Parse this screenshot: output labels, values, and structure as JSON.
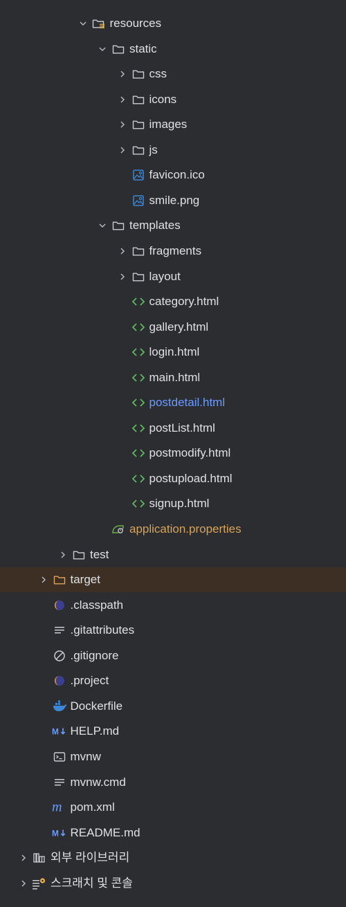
{
  "colors": {
    "background": "#2b2d30",
    "text": "#dfe1e5",
    "modified_blue": "#6b9bff",
    "ignored_orange": "#d6a35a",
    "highlight_row": "#3d2f23",
    "html_icon": "#5fb760",
    "image_icon": "#3d86d8"
  },
  "tree": {
    "items": [
      {
        "label": "resources",
        "depth": 3,
        "chevron": "down",
        "icon": "resources-folder-icon"
      },
      {
        "label": "static",
        "depth": 4,
        "chevron": "down",
        "icon": "folder-icon"
      },
      {
        "label": "css",
        "depth": 5,
        "chevron": "right",
        "icon": "folder-icon"
      },
      {
        "label": "icons",
        "depth": 5,
        "chevron": "right",
        "icon": "folder-icon"
      },
      {
        "label": "images",
        "depth": 5,
        "chevron": "right",
        "icon": "folder-icon"
      },
      {
        "label": "js",
        "depth": 5,
        "chevron": "right",
        "icon": "folder-icon"
      },
      {
        "label": "favicon.ico",
        "depth": 5,
        "chevron": "none",
        "icon": "image-file-icon"
      },
      {
        "label": "smile.png",
        "depth": 5,
        "chevron": "none",
        "icon": "image-file-icon"
      },
      {
        "label": "templates",
        "depth": 4,
        "chevron": "down",
        "icon": "folder-icon"
      },
      {
        "label": "fragments",
        "depth": 5,
        "chevron": "right",
        "icon": "folder-icon"
      },
      {
        "label": "layout",
        "depth": 5,
        "chevron": "right",
        "icon": "folder-icon"
      },
      {
        "label": "category.html",
        "depth": 5,
        "chevron": "none",
        "icon": "html-file-icon"
      },
      {
        "label": "gallery.html",
        "depth": 5,
        "chevron": "none",
        "icon": "html-file-icon"
      },
      {
        "label": "login.html",
        "depth": 5,
        "chevron": "none",
        "icon": "html-file-icon"
      },
      {
        "label": "main.html",
        "depth": 5,
        "chevron": "none",
        "icon": "html-file-icon"
      },
      {
        "label": "postdetail.html",
        "depth": 5,
        "chevron": "none",
        "icon": "html-file-icon",
        "style": "blue"
      },
      {
        "label": "postList.html",
        "depth": 5,
        "chevron": "none",
        "icon": "html-file-icon"
      },
      {
        "label": "postmodify.html",
        "depth": 5,
        "chevron": "none",
        "icon": "html-file-icon"
      },
      {
        "label": "postupload.html",
        "depth": 5,
        "chevron": "none",
        "icon": "html-file-icon"
      },
      {
        "label": "signup.html",
        "depth": 5,
        "chevron": "none",
        "icon": "html-file-icon"
      },
      {
        "label": "application.properties",
        "depth": 4,
        "chevron": "none",
        "icon": "properties-file-icon",
        "style": "orange"
      },
      {
        "label": "test",
        "depth": 2,
        "chevron": "right",
        "icon": "folder-icon"
      },
      {
        "label": "target",
        "depth": 1,
        "chevron": "right",
        "icon": "folder-orange-icon",
        "highlight": true
      },
      {
        "label": ".classpath",
        "depth": 1,
        "chevron": "none",
        "icon": "eclipse-icon"
      },
      {
        "label": ".gitattributes",
        "depth": 1,
        "chevron": "none",
        "icon": "text-lines-icon"
      },
      {
        "label": ".gitignore",
        "depth": 1,
        "chevron": "none",
        "icon": "ignore-icon"
      },
      {
        "label": ".project",
        "depth": 1,
        "chevron": "none",
        "icon": "eclipse-icon"
      },
      {
        "label": "Dockerfile",
        "depth": 1,
        "chevron": "none",
        "icon": "docker-icon"
      },
      {
        "label": "HELP.md",
        "depth": 1,
        "chevron": "none",
        "icon": "markdown-icon"
      },
      {
        "label": "mvnw",
        "depth": 1,
        "chevron": "none",
        "icon": "terminal-icon"
      },
      {
        "label": "mvnw.cmd",
        "depth": 1,
        "chevron": "none",
        "icon": "text-lines-icon"
      },
      {
        "label": "pom.xml",
        "depth": 1,
        "chevron": "none",
        "icon": "maven-icon"
      },
      {
        "label": "README.md",
        "depth": 1,
        "chevron": "none",
        "icon": "markdown-icon"
      },
      {
        "label": "외부 라이브러리",
        "depth": 0,
        "chevron": "right",
        "icon": "library-icon"
      },
      {
        "label": "스크래치 및 콘솔",
        "depth": 0,
        "chevron": "right",
        "icon": "scratch-icon"
      }
    ]
  }
}
